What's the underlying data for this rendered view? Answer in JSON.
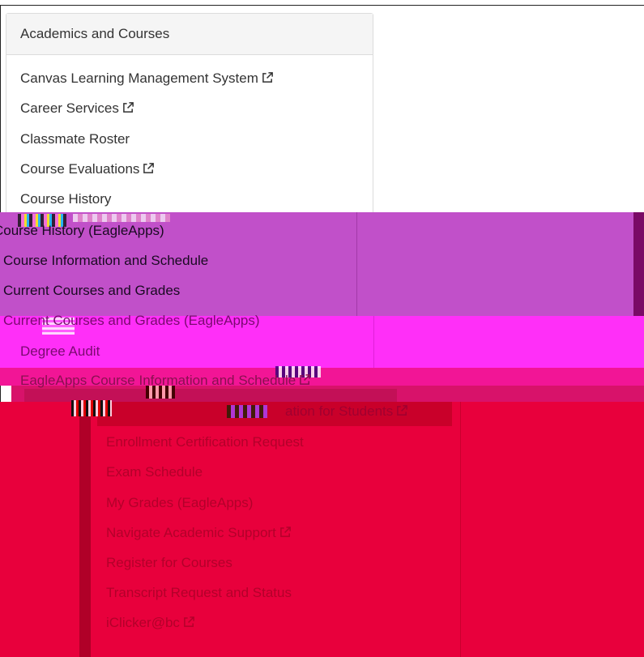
{
  "panel": {
    "title": "Academics and Courses"
  },
  "links": [
    {
      "label": "Canvas Learning Management System",
      "external": true,
      "icon": "external-link-icon"
    },
    {
      "label": "Career Services",
      "external": true,
      "icon": "external-link-icon"
    },
    {
      "label": "Classmate Roster",
      "external": false
    },
    {
      "label": "Course Evaluations",
      "external": true,
      "icon": "external-link-icon"
    },
    {
      "label": "Course History",
      "external": false
    },
    {
      "label": "Course History (EagleApps)",
      "external": false
    },
    {
      "label": "Course Information and Schedule",
      "external": false
    },
    {
      "label": "Current Courses and Grades",
      "external": false
    },
    {
      "label": "Current Courses and Grades (EagleApps)",
      "external": false
    },
    {
      "label": "Degree Audit",
      "external": false
    },
    {
      "label": "EagleApps Course Information and Schedule",
      "external": true,
      "icon": "external-link-icon"
    },
    {
      "label": "ation for Students",
      "external": true,
      "icon": "external-link-icon"
    },
    {
      "label": "Enrollment Certification Request",
      "external": false
    },
    {
      "label": "Exam Schedule",
      "external": false
    },
    {
      "label": "My Grades (EagleApps)",
      "external": false
    },
    {
      "label": "Navigate Academic Support",
      "external": true,
      "icon": "external-link-icon"
    },
    {
      "label": "Register for Courses",
      "external": false
    },
    {
      "label": "Transcript Request and Status",
      "external": false
    },
    {
      "label": "iClicker@bc",
      "external": true,
      "icon": "external-link-icon"
    }
  ],
  "colors": {
    "text": "#333333",
    "header_bg": "#f5f5f5",
    "glitch_purple": "#c150c9",
    "glitch_magenta": "#ff2ff8",
    "glitch_red": "#e8003c"
  }
}
